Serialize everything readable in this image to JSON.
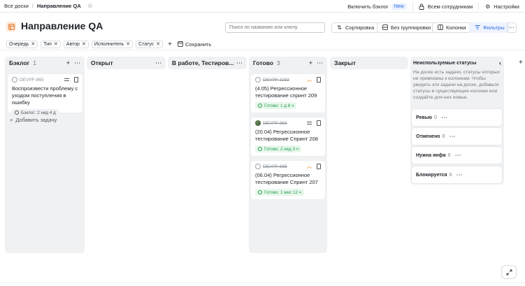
{
  "topbar": {
    "crumb_root": "Все доски",
    "crumb_sep": "/",
    "crumb_current": "Направление QA",
    "backlog_toggle": "Включить бэклог",
    "new_badge": "New",
    "all_employees": "Всем сотрудникам",
    "settings": "Настройки"
  },
  "header": {
    "title": "Направление QA",
    "board_icon_text": "☐",
    "search_placeholder": "Поиск по названию или ключу",
    "sort": "Сортировка",
    "grouping": "Без группировки",
    "columns": "Колонки",
    "filters": "Фильтры",
    "more": "⋯"
  },
  "filters": {
    "chips": [
      "Очередь",
      "Тип",
      "Автор",
      "Исполнитель",
      "Статус"
    ],
    "save": "Сохранить"
  },
  "columns": [
    {
      "title": "Бэклог",
      "count": "1"
    },
    {
      "title": "Открыт",
      "count": ""
    },
    {
      "title": "В работе, Тестиров...",
      "count": ""
    },
    {
      "title": "Готово",
      "count": "3"
    },
    {
      "title": "Закрыт",
      "count": ""
    }
  ],
  "cards": {
    "backlog": {
      "key": "DEVPF-865",
      "title": "Воспроизвести проблему с уходом поступления в ошибку",
      "status": "Бэклог: 2 нед 4 д"
    },
    "done1": {
      "key": "DEVPF-1182",
      "title": "(4.05) Регрессионное тестирование спринт 209",
      "status": "Готово: 1 д 8 ч"
    },
    "done2": {
      "key": "DEVPF-963",
      "title": "(20.04) Регрессионное тестирование Спринт 208",
      "status": "Готово: 2 нед 3 ч"
    },
    "done3": {
      "key": "DEVPF-685",
      "title": "(06.04) Регрессионное тестирование Спринт 207",
      "status": "Готово: 1 мес 12 ч"
    }
  },
  "add_task": "Добавить задачу",
  "unused": {
    "title": "Неиспользуемые статусы",
    "description": "На доске есть задачи, статусы которых не привязаны к колонкам. Чтобы увидеть эти задачи на доске, добавьте статусы в существующие колонки или создайте для них новые.",
    "statuses": [
      {
        "name": "Ревью",
        "count": "0"
      },
      {
        "name": "Отменено",
        "count": "0"
      },
      {
        "name": "Нужна инфа",
        "count": "0"
      },
      {
        "name": "Блокируется",
        "count": "0"
      }
    ]
  },
  "colors": {
    "accent": "#2f6fe0",
    "done_green": "#1e9e4a",
    "column_bg": "#f0f1f3",
    "priority_orange": "#f08a1c"
  }
}
